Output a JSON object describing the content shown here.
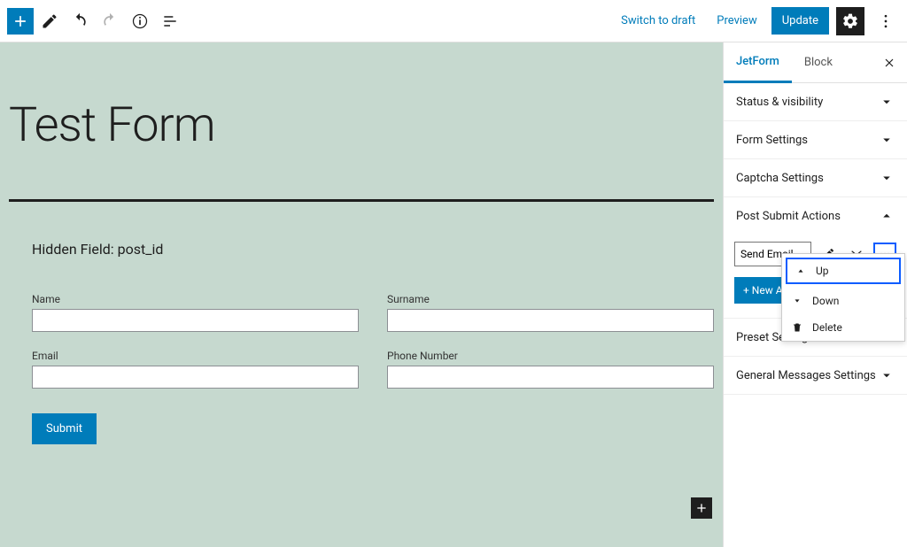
{
  "topbar": {
    "switch_draft": "Switch to draft",
    "preview": "Preview",
    "update": "Update"
  },
  "canvas": {
    "title": "Test Form",
    "hidden_field": "Hidden Field: post_id",
    "fields": {
      "name": "Name",
      "surname": "Surname",
      "email": "Email",
      "phone": "Phone Number"
    },
    "submit": "Submit"
  },
  "sidebar": {
    "tabs": {
      "jetform": "JetForm",
      "block": "Block"
    },
    "panels": {
      "status": "Status & visibility",
      "form_settings": "Form Settings",
      "captcha": "Captcha Settings",
      "post_submit": "Post Submit Actions",
      "preset": "Preset Settings",
      "general_messages": "General Messages Settings"
    },
    "actions": {
      "select_value": "Send Email",
      "new_action": "+ New Action"
    },
    "dropdown": {
      "up": "Up",
      "down": "Down",
      "delete": "Delete"
    }
  }
}
